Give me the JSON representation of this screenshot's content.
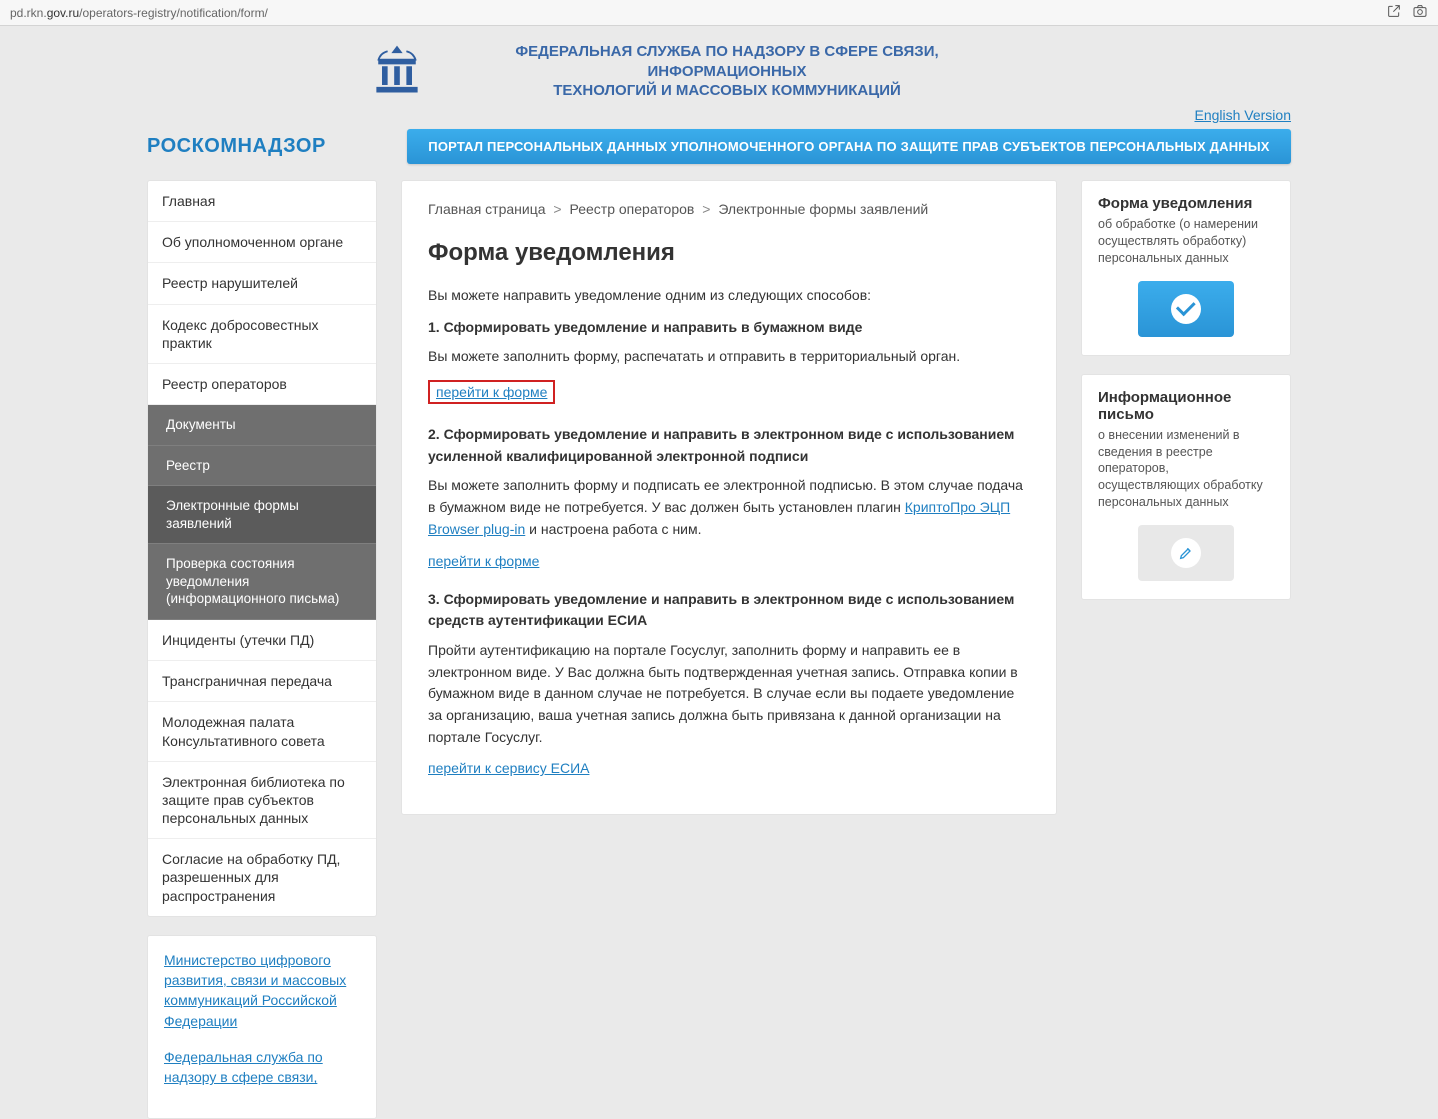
{
  "browser": {
    "url_prefix": "pd.rkn.",
    "url_gov": "gov.ru",
    "url_suffix": "/operators-registry/notification/form/"
  },
  "header": {
    "agency_title_line1": "ФЕДЕРАЛЬНАЯ СЛУЖБА ПО НАДЗОРУ В СФЕРЕ СВЯЗИ, ИНФОРМАЦИОННЫХ",
    "agency_title_line2": "ТЕХНОЛОГИЙ И МАССОВЫХ КОММУНИКАЦИЙ",
    "english_link": "English Version",
    "site_logo": "РОСКОМНАДЗОР",
    "portal_banner": "ПОРТАЛ ПЕРСОНАЛЬНЫХ ДАННЫХ УПОЛНОМОЧЕННОГО ОРГАНА ПО ЗАЩИТЕ ПРАВ СУБЪЕКТОВ ПЕРСОНАЛЬНЫХ ДАННЫХ"
  },
  "menu": {
    "items": [
      "Главная",
      "Об уполномоченном органе",
      "Реестр нарушителей",
      "Кодекс добросовестных практик",
      "Реестр операторов"
    ],
    "submenu": [
      "Документы",
      "Реестр",
      "Электронные формы заявлений",
      "Проверка состояния уведомления (информационного письма)"
    ],
    "items_after": [
      "Инциденты (утечки ПД)",
      "Трансграничная передача",
      "Молодежная палата Консультативного совета",
      "Электронная библиотека по защите прав субъектов персональных данных",
      "Согласие на обработку ПД, разрешенных для распространения"
    ]
  },
  "external_links": {
    "link1": "Министерство цифрового развития, связи и массовых коммуникаций Российской Федерации",
    "link2": "Федеральная служба по надзору в сфере связи,"
  },
  "breadcrumb": {
    "part1": "Главная страница",
    "part2": "Реестр операторов",
    "part3": "Электронные формы заявлений"
  },
  "content": {
    "title": "Форма уведомления",
    "intro": "Вы можете направить уведомление одним из следующих способов:",
    "sec1_head": "1. Сформировать уведомление и направить в бумажном виде",
    "sec1_text": "Вы можете заполнить форму, распечатать и отправить в территориальный орган.",
    "link_form": "перейти к форме",
    "sec2_head": "2. Сформировать уведомление и направить в электронном виде с использованием усиленной квалифицированной электронной подписи",
    "sec2_text_a": "Вы можете заполнить форму и подписать ее электронной подписью. В этом случае подача в бумажном виде не потребуется. У вас должен быть установлен плагин ",
    "sec2_plugin_link": "КриптоПро ЭЦП Browser plug-in",
    "sec2_text_b": " и настроена работа с ним.",
    "sec3_head": "3. Сформировать уведомление и направить в электронном виде с использованием средств аутентификации ЕСИА",
    "sec3_text": "Пройти аутентификацию на портале Госуслуг, заполнить форму и направить ее в электронном виде. У Вас должна быть подтвержденная учетная запись. Отправка копии в бумажном виде в данном случае не потребуется. В случае если вы подаете уведомление за организацию, ваша учетная запись должна быть привязана к данной организации на портале Госуслуг.",
    "link_esia": "перейти к сервису ЕСИА"
  },
  "right": {
    "card1": {
      "title": "Форма уведомления",
      "sub": "об обработке (о намерении осуществлять обработку) персональных данных"
    },
    "card2": {
      "title": "Информационное письмо",
      "sub": "о внесении изменений в сведения в реестре операторов, осуществляющих обработку персональных данных"
    }
  }
}
